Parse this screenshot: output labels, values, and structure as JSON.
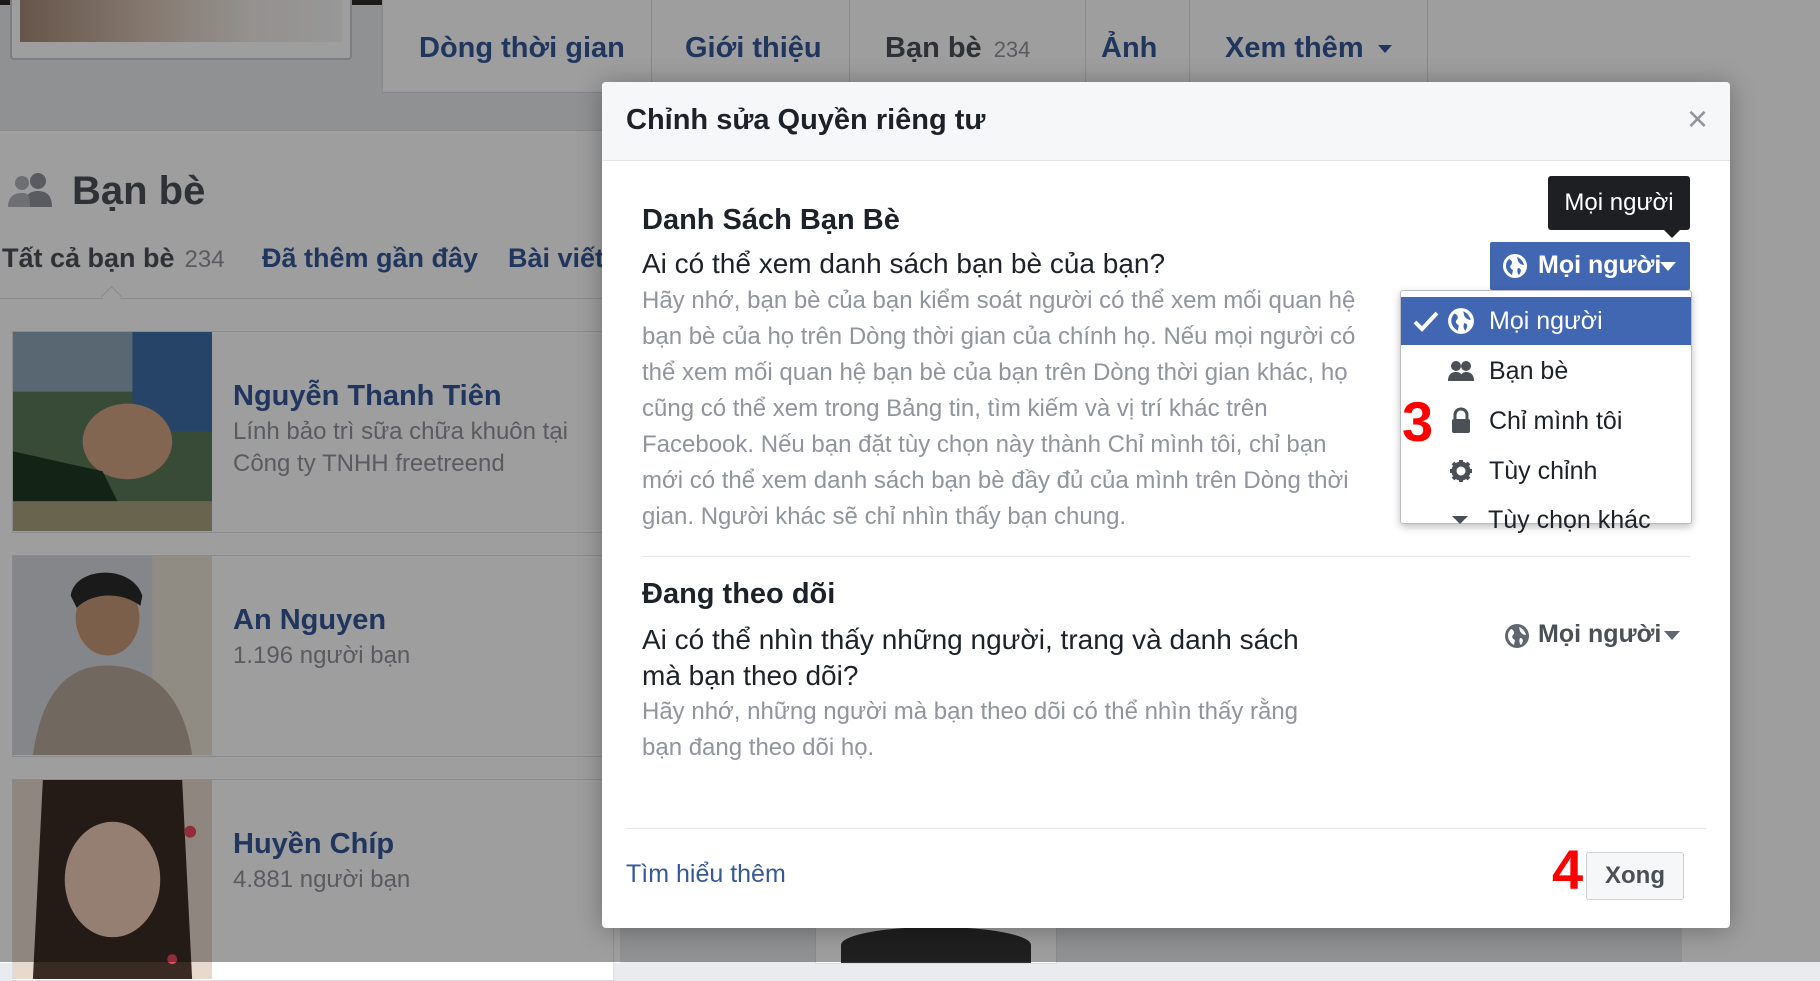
{
  "profile_nav": {
    "tabs": [
      {
        "label": "Dòng thời gian"
      },
      {
        "label": "Giới thiệu"
      },
      {
        "label": "Bạn bè",
        "count": "234"
      },
      {
        "label": "Ảnh"
      },
      {
        "label": "Xem thêm"
      }
    ]
  },
  "friends_panel": {
    "title": "Bạn bè",
    "tabs": [
      {
        "label": "Tất cả bạn bè",
        "count": "234"
      },
      {
        "label": "Đã thêm gần đây"
      },
      {
        "label": "Bài viết"
      }
    ],
    "friends": [
      {
        "name": "Nguyễn Thanh Tiên",
        "line1": "Lính bảo trì sữa chữa khuôn tại",
        "line2": "Công ty TNHH freetreend"
      },
      {
        "name": "An Nguyen",
        "line1": "1.196 người bạn"
      },
      {
        "name": "Huyền Chíp",
        "line1": "4.881 người bạn"
      }
    ]
  },
  "dialog": {
    "title": "Chỉnh sửa Quyền riêng tư",
    "close_symbol": "×",
    "section1": {
      "title": "Danh Sách Bạn Bè",
      "question": "Ai có thể xem danh sách bạn bè của bạn?",
      "description": "Hãy nhớ, bạn bè của bạn kiểm soát người có thể xem mối quan hệ bạn bè của họ trên Dòng thời gian của chính họ. Nếu mọi người có thể xem mối quan hệ bạn bè của bạn trên Dòng thời gian khác, họ cũng có thể xem trong Bảng tin, tìm kiếm và vị trí khác trên Facebook. Nếu bạn đặt tùy chọn này thành Chỉ mình tôi, chỉ bạn mới có thể xem danh sách bạn bè đầy đủ của mình trên Dòng thời gian. Người khác sẽ chỉ nhìn thấy bạn chung.",
      "audience_button": "Mọi người",
      "tooltip": "Mọi người"
    },
    "audience_menu": {
      "items": [
        {
          "label": "Mọi người",
          "icon": "globe-icon",
          "selected": true
        },
        {
          "label": "Bạn bè",
          "icon": "friends-icon"
        },
        {
          "label": "Chỉ mình tôi",
          "icon": "lock-icon"
        },
        {
          "label": "Tùy chỉnh",
          "icon": "gear-icon"
        },
        {
          "label": "Tùy chọn khác",
          "icon": "triangle-down-icon"
        }
      ]
    },
    "section2": {
      "title": "Đang theo dõi",
      "question": "Ai có thể nhìn thấy những người, trang và danh sách mà bạn theo dõi?",
      "description": "Hãy nhớ, những người mà bạn theo dõi có thể nhìn thấy rằng bạn đang theo dõi họ.",
      "audience_button": "Mọi người"
    },
    "learn_more": "Tìm hiểu thêm",
    "done_button": "Xong"
  },
  "annotations": {
    "step3": "3",
    "step4": "4"
  },
  "colors": {
    "accent": "#4267b2",
    "link": "#365899",
    "step_marker": "#ff0000"
  }
}
